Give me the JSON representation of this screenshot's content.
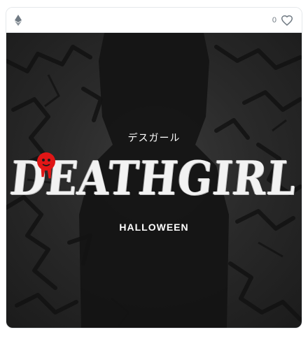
{
  "card": {
    "chain_icon": "ethereum-icon",
    "like_count": "0",
    "like_icon": "heart-icon"
  },
  "artwork": {
    "japanese_title": "デスガール",
    "title_left": "DEATH",
    "title_right": "GIRL",
    "subtitle": "HALLOWEEN",
    "colors": {
      "background": "#2a2a2a",
      "silhouette": "#151515",
      "title": "#f2f2f2",
      "accent": "#e01616"
    }
  }
}
